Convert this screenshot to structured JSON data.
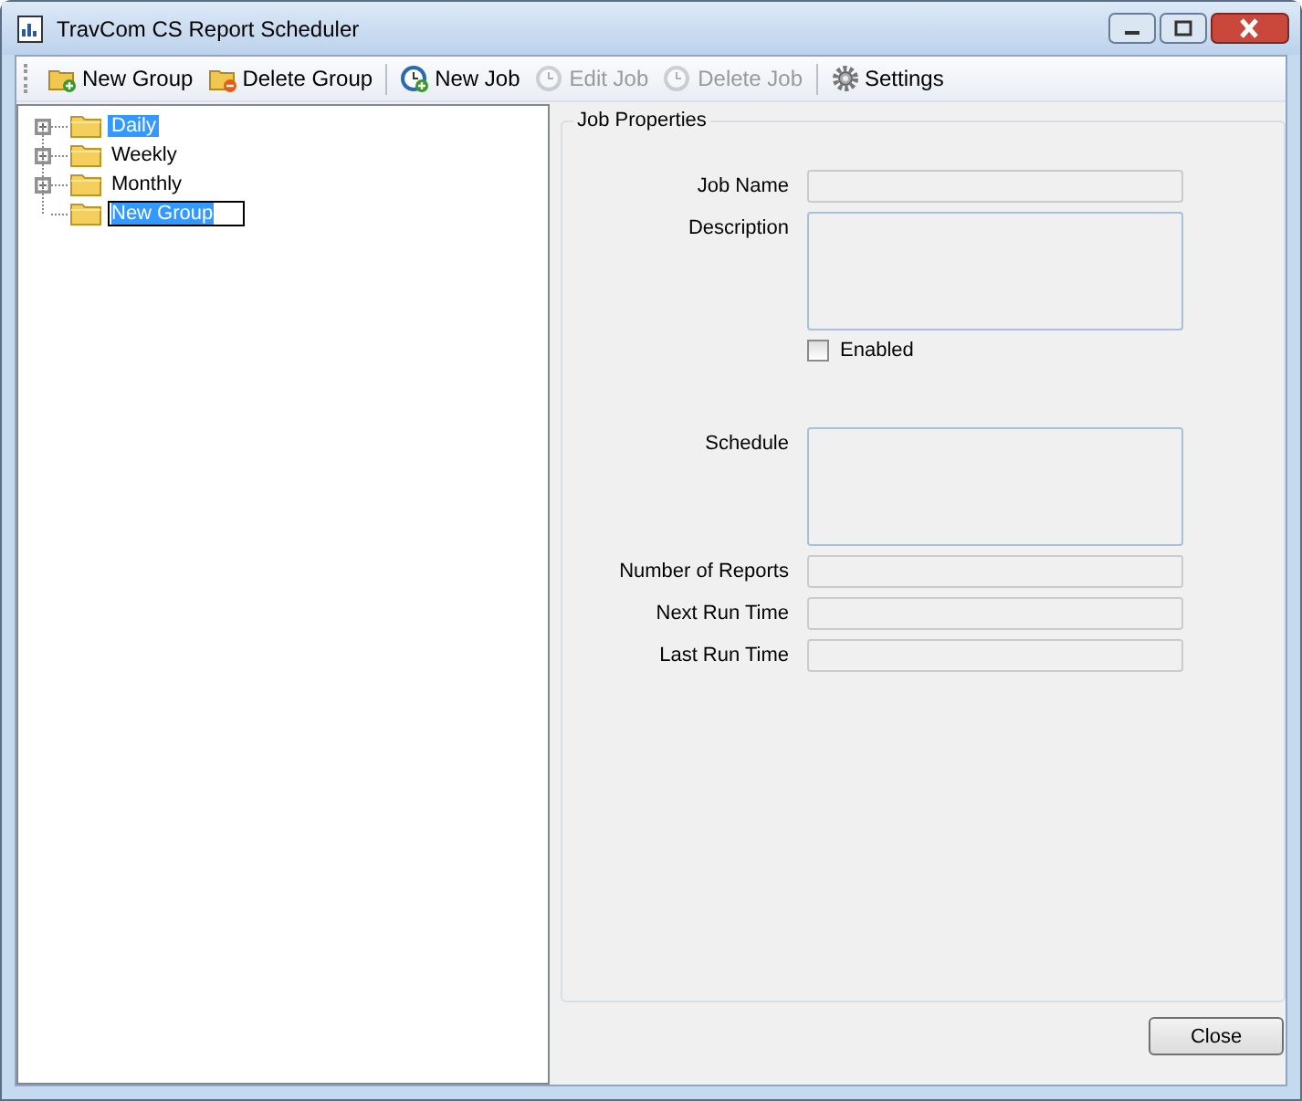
{
  "window": {
    "title": "TravCom CS Report Scheduler"
  },
  "toolbar": [
    {
      "kind": "button",
      "label": "New Group",
      "disabled": false
    },
    {
      "kind": "button",
      "label": "Delete Group",
      "disabled": false
    },
    {
      "kind": "separator"
    },
    {
      "kind": "button",
      "label": "New Job",
      "disabled": false
    },
    {
      "kind": "button",
      "label": "Edit Job",
      "disabled": true
    },
    {
      "kind": "button",
      "label": "Delete Job",
      "disabled": true
    },
    {
      "kind": "separator"
    },
    {
      "kind": "button",
      "label": "Settings",
      "disabled": false
    }
  ],
  "tree": [
    {
      "label": "Daily",
      "expandable": true,
      "selected": true,
      "editing": false
    },
    {
      "label": "Weekly",
      "expandable": true,
      "selected": false,
      "editing": false
    },
    {
      "label": "Monthly",
      "expandable": true,
      "selected": false,
      "editing": false
    },
    {
      "label": "New Group",
      "expandable": false,
      "selected": false,
      "editing": true
    }
  ],
  "job_properties": {
    "title": "Job Properties",
    "fields": [
      {
        "kind": "text",
        "label": "Job Name"
      },
      {
        "kind": "multiline",
        "label": "Description"
      },
      {
        "kind": "checkbox",
        "label": "Enabled",
        "checked": false
      },
      {
        "kind": "spacer"
      },
      {
        "kind": "multiline",
        "label": "Schedule"
      },
      {
        "kind": "text",
        "label": "Number of Reports"
      },
      {
        "kind": "text",
        "label": "Next Run Time"
      },
      {
        "kind": "text",
        "label": "Last Run Time"
      }
    ]
  },
  "buttons": [
    {
      "label": "Close"
    }
  ]
}
